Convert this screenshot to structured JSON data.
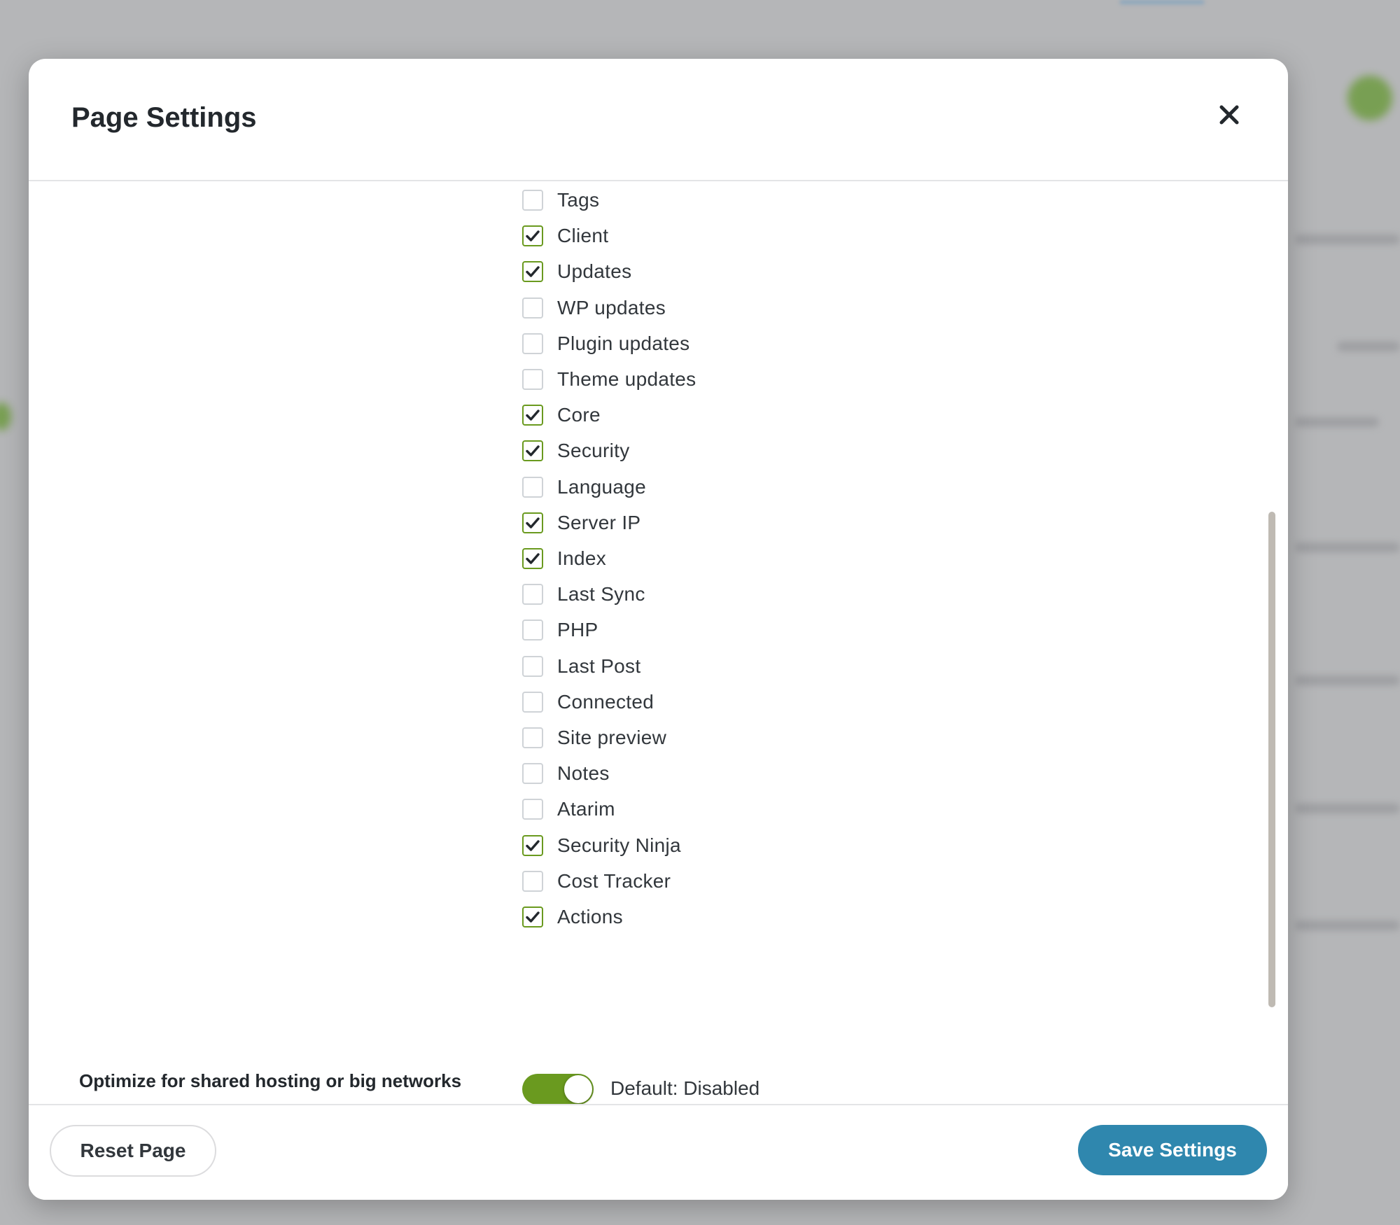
{
  "modal": {
    "title": "Page Settings",
    "close_icon": "close-icon"
  },
  "columns": [
    {
      "label": "Tags",
      "checked": false
    },
    {
      "label": "Client",
      "checked": true
    },
    {
      "label": "Updates",
      "checked": true
    },
    {
      "label": "WP updates",
      "checked": false
    },
    {
      "label": "Plugin updates",
      "checked": false
    },
    {
      "label": "Theme updates",
      "checked": false
    },
    {
      "label": "Core",
      "checked": true
    },
    {
      "label": "Security",
      "checked": true
    },
    {
      "label": "Language",
      "checked": false
    },
    {
      "label": "Server IP",
      "checked": true
    },
    {
      "label": "Index",
      "checked": true
    },
    {
      "label": "Last Sync",
      "checked": false
    },
    {
      "label": "PHP",
      "checked": false
    },
    {
      "label": "Last Post",
      "checked": false
    },
    {
      "label": "Connected",
      "checked": false
    },
    {
      "label": "Site preview",
      "checked": false
    },
    {
      "label": "Notes",
      "checked": false
    },
    {
      "label": "Atarim",
      "checked": false
    },
    {
      "label": "Security Ninja",
      "checked": true
    },
    {
      "label": "Cost Tracker",
      "checked": false
    },
    {
      "label": "Actions",
      "checked": true
    }
  ],
  "optimize": {
    "label": "Optimize for shared hosting or big networks",
    "enabled": true,
    "hint": "Default: Disabled"
  },
  "footer": {
    "reset_label": "Reset Page",
    "save_label": "Save Settings"
  },
  "colors": {
    "accent_green": "#6a9a1f",
    "save_blue": "#2f87ae",
    "title_text": "#23282d"
  }
}
